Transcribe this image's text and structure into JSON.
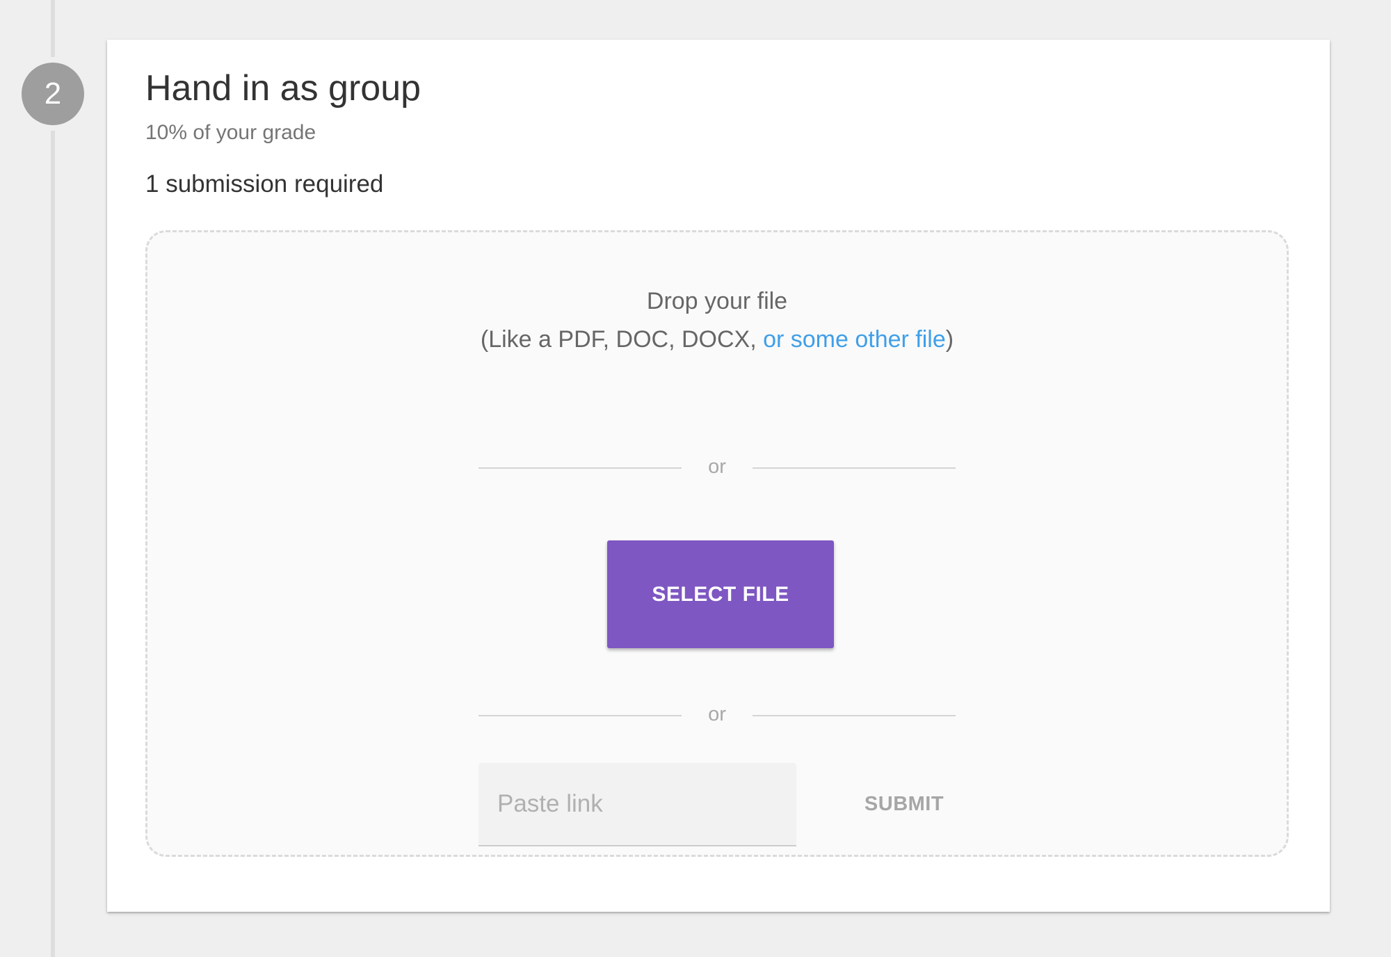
{
  "step": {
    "number": "2"
  },
  "card": {
    "title": "Hand in as group",
    "subtitle": "10% of your grade",
    "requirement": "1 submission required"
  },
  "dropzone": {
    "heading": "Drop your file",
    "hint_prefix": "(Like a PDF, DOC, DOCX, ",
    "hint_link": "or some other file",
    "hint_suffix": ")",
    "divider_label_1": "or",
    "divider_label_2": "or",
    "select_button_label": "SELECT FILE",
    "link_input_placeholder": "Paste link",
    "link_input_value": "",
    "submit_button_label": "SUBMIT"
  },
  "colors": {
    "accent_button": "#7e57c2",
    "link": "#3f9fe8",
    "step_badge": "#9e9e9e",
    "background": "#efefef"
  }
}
